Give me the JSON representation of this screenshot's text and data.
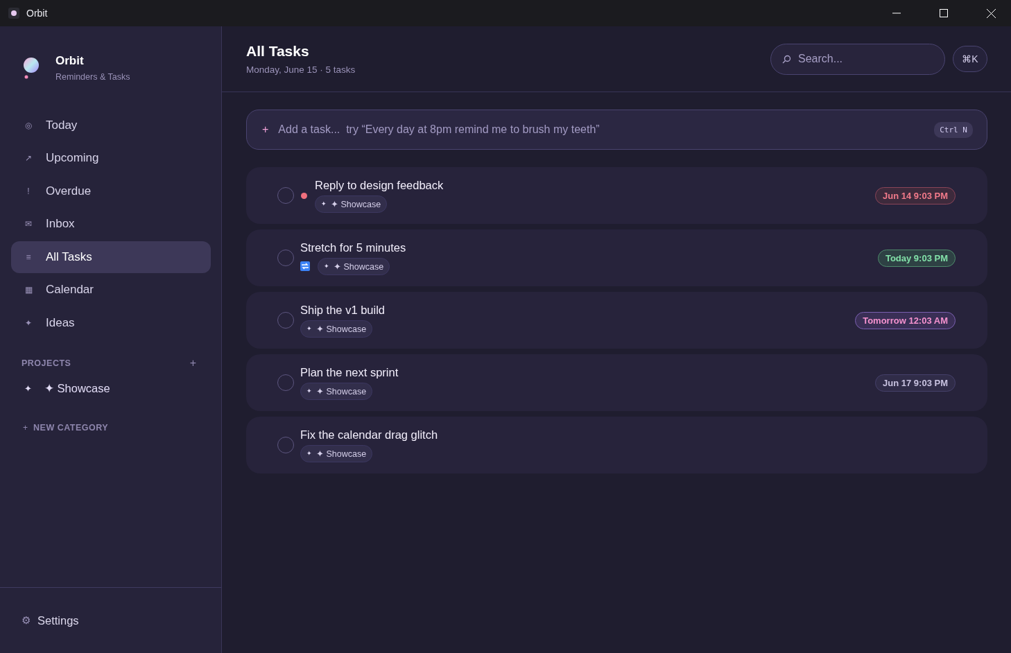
{
  "window": {
    "title": "Orbit"
  },
  "brand": {
    "name": "Orbit",
    "subtitle": "Reminders & Tasks"
  },
  "nav": [
    {
      "icon": "◎",
      "label": "Today",
      "selected": false
    },
    {
      "icon": "↗",
      "label": "Upcoming",
      "selected": false
    },
    {
      "icon": "!",
      "label": "Overdue",
      "selected": false
    },
    {
      "icon": "✉",
      "label": "Inbox",
      "selected": false
    },
    {
      "icon": "≡",
      "label": "All Tasks",
      "selected": true
    },
    {
      "icon": "▦",
      "label": "Calendar",
      "selected": false
    },
    {
      "icon": "✦",
      "label": "Ideas",
      "selected": false
    }
  ],
  "projects": {
    "heading": "PROJECTS",
    "add": "+",
    "items": [
      {
        "icon": "✦",
        "label": "✦ Showcase"
      }
    ]
  },
  "new_category": {
    "icon": "+",
    "label": "NEW CATEGORY"
  },
  "settings": {
    "icon": "⚙",
    "label": "Settings"
  },
  "header": {
    "title": "All Tasks",
    "subtitle": "Monday, June 15 · 5 tasks",
    "search": {
      "placeholder": "Search..."
    },
    "shortcut": "⌘K"
  },
  "add_task": {
    "icon": "+",
    "placeholder": "Add a task...  try “Every day at 8pm remind me to brush my teeth”",
    "shortcut": "Ctrl N"
  },
  "tasks": [
    {
      "title": "Reply to design feedback",
      "done": false,
      "urgent": true,
      "repeat": false,
      "tag": {
        "icon": "✦",
        "label": "✦ Showcase"
      },
      "due": {
        "kind": "overdue",
        "label": "Jun 14 9:03 PM"
      }
    },
    {
      "title": "Stretch for 5 minutes",
      "done": false,
      "urgent": false,
      "repeat": true,
      "tag": {
        "icon": "✦",
        "label": "✦ Showcase"
      },
      "due": {
        "kind": "today",
        "label": "Today 9:03 PM"
      }
    },
    {
      "title": "Ship the v1 build",
      "done": false,
      "urgent": false,
      "repeat": false,
      "tag": {
        "icon": "✦",
        "label": "✦ Showcase"
      },
      "due": {
        "kind": "soon",
        "label": "Tomorrow 12:03 AM"
      }
    },
    {
      "title": "Plan the next sprint",
      "done": false,
      "urgent": false,
      "repeat": false,
      "tag": {
        "icon": "✦",
        "label": "✦ Showcase"
      },
      "due": {
        "kind": "later",
        "label": "Jun 17 9:03 PM"
      }
    },
    {
      "title": "Fix the calendar drag glitch",
      "done": false,
      "urgent": false,
      "repeat": false,
      "tag": {
        "icon": "✦",
        "label": "✦ Showcase"
      }
    }
  ]
}
